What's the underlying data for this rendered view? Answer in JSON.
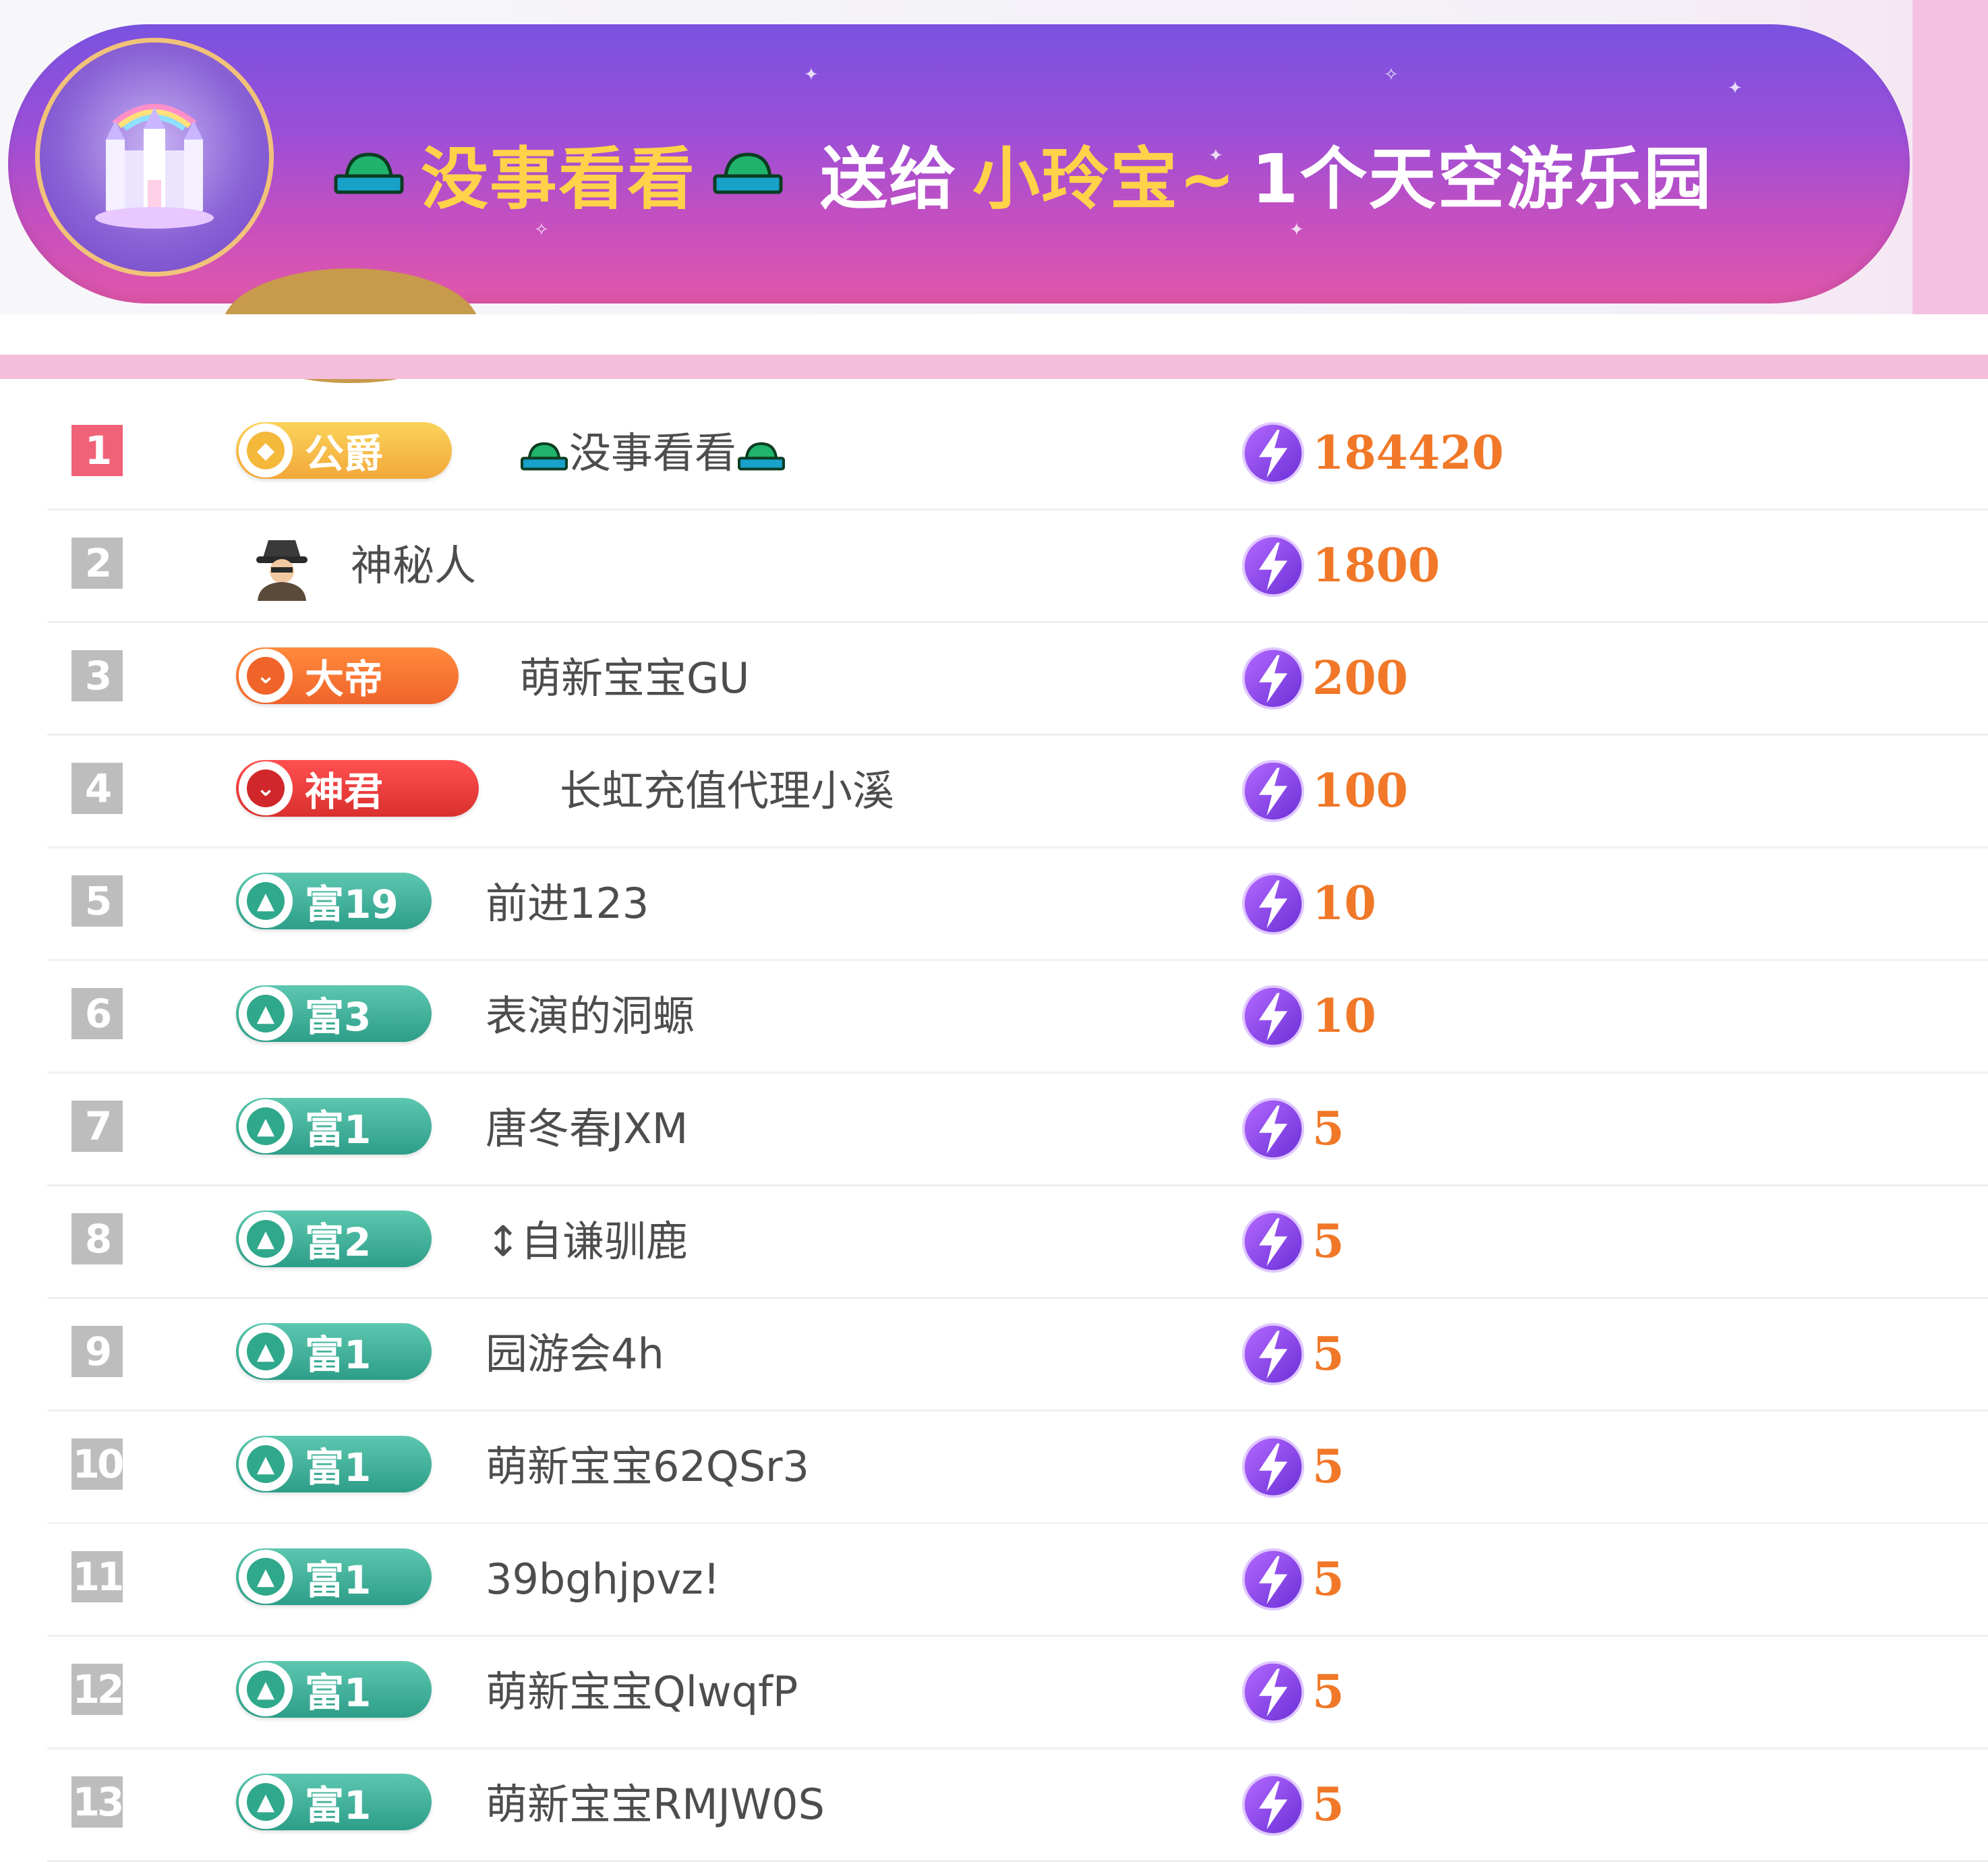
{
  "banner": {
    "sender": "没事看看",
    "verb": "送给",
    "recipient": "小玲宝~",
    "gift": "1个天空游乐园"
  },
  "rows": [
    {
      "rank": "1",
      "badge": "公爵",
      "badge_style": "gold",
      "name": "没事看看",
      "hat_icons": true,
      "score": "184420"
    },
    {
      "rank": "2",
      "badge": "",
      "badge_style": "none",
      "icon": "spy-icon",
      "name": "神秘人",
      "score": "1800"
    },
    {
      "rank": "3",
      "badge": "大帝",
      "badge_style": "orange",
      "name": "萌新宝宝GU",
      "score": "200"
    },
    {
      "rank": "4",
      "badge": "神君",
      "badge_style": "red",
      "name": "长虹充值代理小溪",
      "score": "100"
    },
    {
      "rank": "5",
      "badge": "富19",
      "badge_style": "teal",
      "name": "前进123",
      "score": "10"
    },
    {
      "rank": "6",
      "badge": "富3",
      "badge_style": "teal",
      "name": "表演的洞螈",
      "score": "10"
    },
    {
      "rank": "7",
      "badge": "富1",
      "badge_style": "teal",
      "name": "唐冬春JXM",
      "score": "5"
    },
    {
      "rank": "8",
      "badge": "富2",
      "badge_style": "teal",
      "name": "↕自谦驯鹿",
      "score": "5"
    },
    {
      "rank": "9",
      "badge": "富1",
      "badge_style": "teal",
      "name": "园游会4h",
      "score": "5"
    },
    {
      "rank": "10",
      "badge": "富1",
      "badge_style": "teal",
      "name": "萌新宝宝62QSr3",
      "score": "5"
    },
    {
      "rank": "11",
      "badge": "富1",
      "badge_style": "teal",
      "name": "39bghjpvz!",
      "score": "5"
    },
    {
      "rank": "12",
      "badge": "富1",
      "badge_style": "teal",
      "name": "萌新宝宝QlwqfP",
      "score": "5"
    },
    {
      "rank": "13",
      "badge": "富1",
      "badge_style": "teal",
      "name": "萌新宝宝RMJW0S",
      "score": "5"
    }
  ],
  "colors": {
    "banner_gold": "#ffd24a",
    "score_orange": "#f07828",
    "rank_first": "#f06277",
    "rank_other": "#bdbdbd",
    "pink_bar": "#f4bddc"
  }
}
